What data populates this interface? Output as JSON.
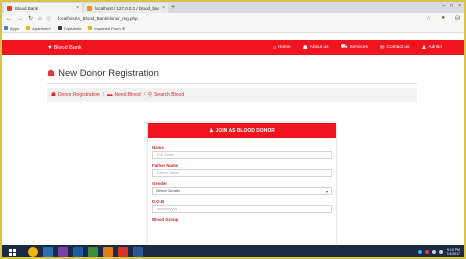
{
  "browser": {
    "tabs": [
      {
        "label": "Blood Bank",
        "close": "×"
      },
      {
        "label": "localhost / 127.0.0.1 / blood_ban",
        "close": "×"
      }
    ],
    "new_tab": "+",
    "window_controls": [
      "–",
      "□",
      "×"
    ],
    "address": "localhost/A_Blood_Bank/donor_reg.php",
    "bookmarks": [
      "Apps",
      "Apartment",
      "TopAdmin",
      "Imported From IE"
    ]
  },
  "navbar": {
    "brand": "Blood Bank",
    "links": [
      {
        "label": "Home",
        "icon": "home-icon"
      },
      {
        "label": "About us",
        "icon": "users-icon"
      },
      {
        "label": "Services",
        "icon": "car-icon"
      },
      {
        "label": "Contact us",
        "icon": "envelope-icon"
      },
      {
        "label": "Admin",
        "icon": "user-icon"
      }
    ]
  },
  "page": {
    "heading": "New Donor Registration",
    "breadcrumbs": [
      {
        "label": "Donor Registration",
        "icon": "users-icon"
      },
      {
        "label": "Need Blood",
        "icon": "bed-icon"
      },
      {
        "label": "Search Blood",
        "icon": "search-icon"
      }
    ],
    "breadcrumb_sep": "/"
  },
  "form": {
    "title": "JOIN AS BLOOD DONOR",
    "fields": {
      "name": {
        "label": "Name",
        "placeholder": "Full Name"
      },
      "father_name": {
        "label": "Father Name",
        "placeholder": "Father Name"
      },
      "gender": {
        "label": "Gender",
        "value": "Select Gender"
      },
      "dob": {
        "label": "D.O.B",
        "placeholder": "mm/dd/yyyy"
      },
      "blood_group": {
        "label": "Blood Group"
      }
    }
  },
  "taskbar": {
    "clock_time": "9:10 PM",
    "clock_date": "7/4/2017"
  },
  "colors": {
    "brand_red": "#f0141e",
    "taskbar": "#1c2a46"
  }
}
